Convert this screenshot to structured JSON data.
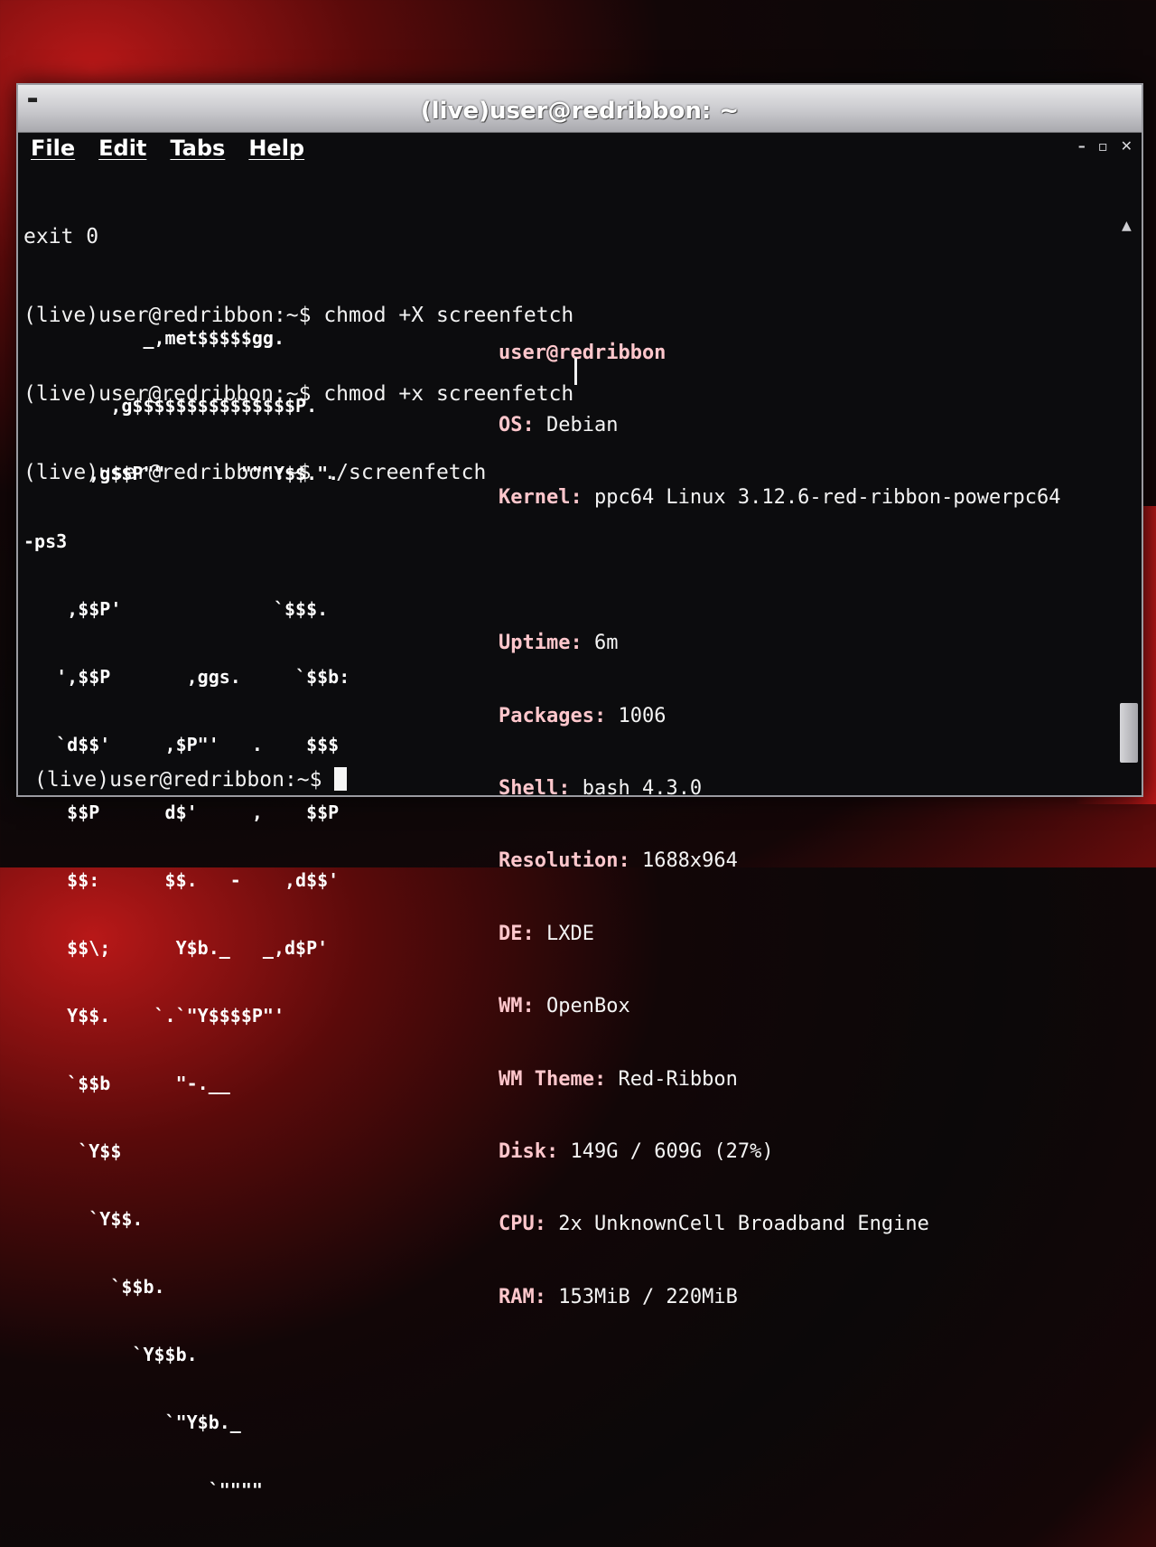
{
  "window": {
    "title": "(live)user@redribbon: ~",
    "controls": {
      "minimize": "–",
      "maximize": "▫",
      "close": "✕"
    }
  },
  "menubar": {
    "items": [
      {
        "label": "File"
      },
      {
        "label": "Edit"
      },
      {
        "label": "Tabs"
      },
      {
        "label": "Help"
      }
    ]
  },
  "terminal": {
    "history": [
      "exit 0",
      "(live)user@redribbon:~$ chmod +X screenfetch",
      "(live)user@redribbon:~$ chmod +x screenfetch",
      "(live)user@redribbon:~$ ./screenfetch"
    ],
    "ascii_art": [
      "           _,met$$$$$gg.",
      "        ,g$$$$$$$$$$$$$$$P.",
      "      ,g$$P\"\"       \"\"\"Y$$.\".",
      "-ps3   ",
      "    ,$$P'              `$$$.",
      "   ',$$P       ,ggs.     `$$b:",
      "   `d$$'     ,$P\"'   .    $$$",
      "    $$P      d$'     ,    $$P",
      "    $$:      $$.   -    ,d$$'",
      "    $$\\;      Y$b._   _,d$P'",
      "    Y$$.    `.`\"Y$$$$P\"'",
      "    `$$b      \"-.__",
      "     `Y$$",
      "      `Y$$.",
      "        `$$b.",
      "          `Y$$b.",
      "             `\"Y$b._",
      "                 `\"\"\"\""
    ],
    "info": {
      "host": "user@redribbon",
      "fields": [
        {
          "key": "OS:",
          "value": " Debian"
        },
        {
          "key": "Kernel:",
          "value": " ppc64 Linux 3.12.6-red-ribbon-powerpc64"
        },
        {
          "key": "",
          "value": ""
        },
        {
          "key": "Uptime:",
          "value": " 6m"
        },
        {
          "key": "Packages:",
          "value": " 1006"
        },
        {
          "key": "Shell:",
          "value": " bash 4.3.0"
        },
        {
          "key": "Resolution:",
          "value": " 1688x964"
        },
        {
          "key": "DE:",
          "value": " LXDE"
        },
        {
          "key": "WM:",
          "value": " OpenBox"
        },
        {
          "key": "WM Theme:",
          "value": " Red-Ribbon"
        },
        {
          "key": "Disk:",
          "value": " 149G / 609G (27%)"
        },
        {
          "key": "CPU:",
          "value": " 2x UnknownCell Broadband Engine"
        },
        {
          "key": "RAM:",
          "value": " 153MiB / 220MiB"
        }
      ]
    },
    "prompt": "(live)user@redribbon:~$ "
  },
  "colors": {
    "terminal_bg": "#0c0c0e",
    "info_key": "#ffc7cc",
    "text": "#f2f2f2",
    "titlebar": "#c9c9cd"
  }
}
